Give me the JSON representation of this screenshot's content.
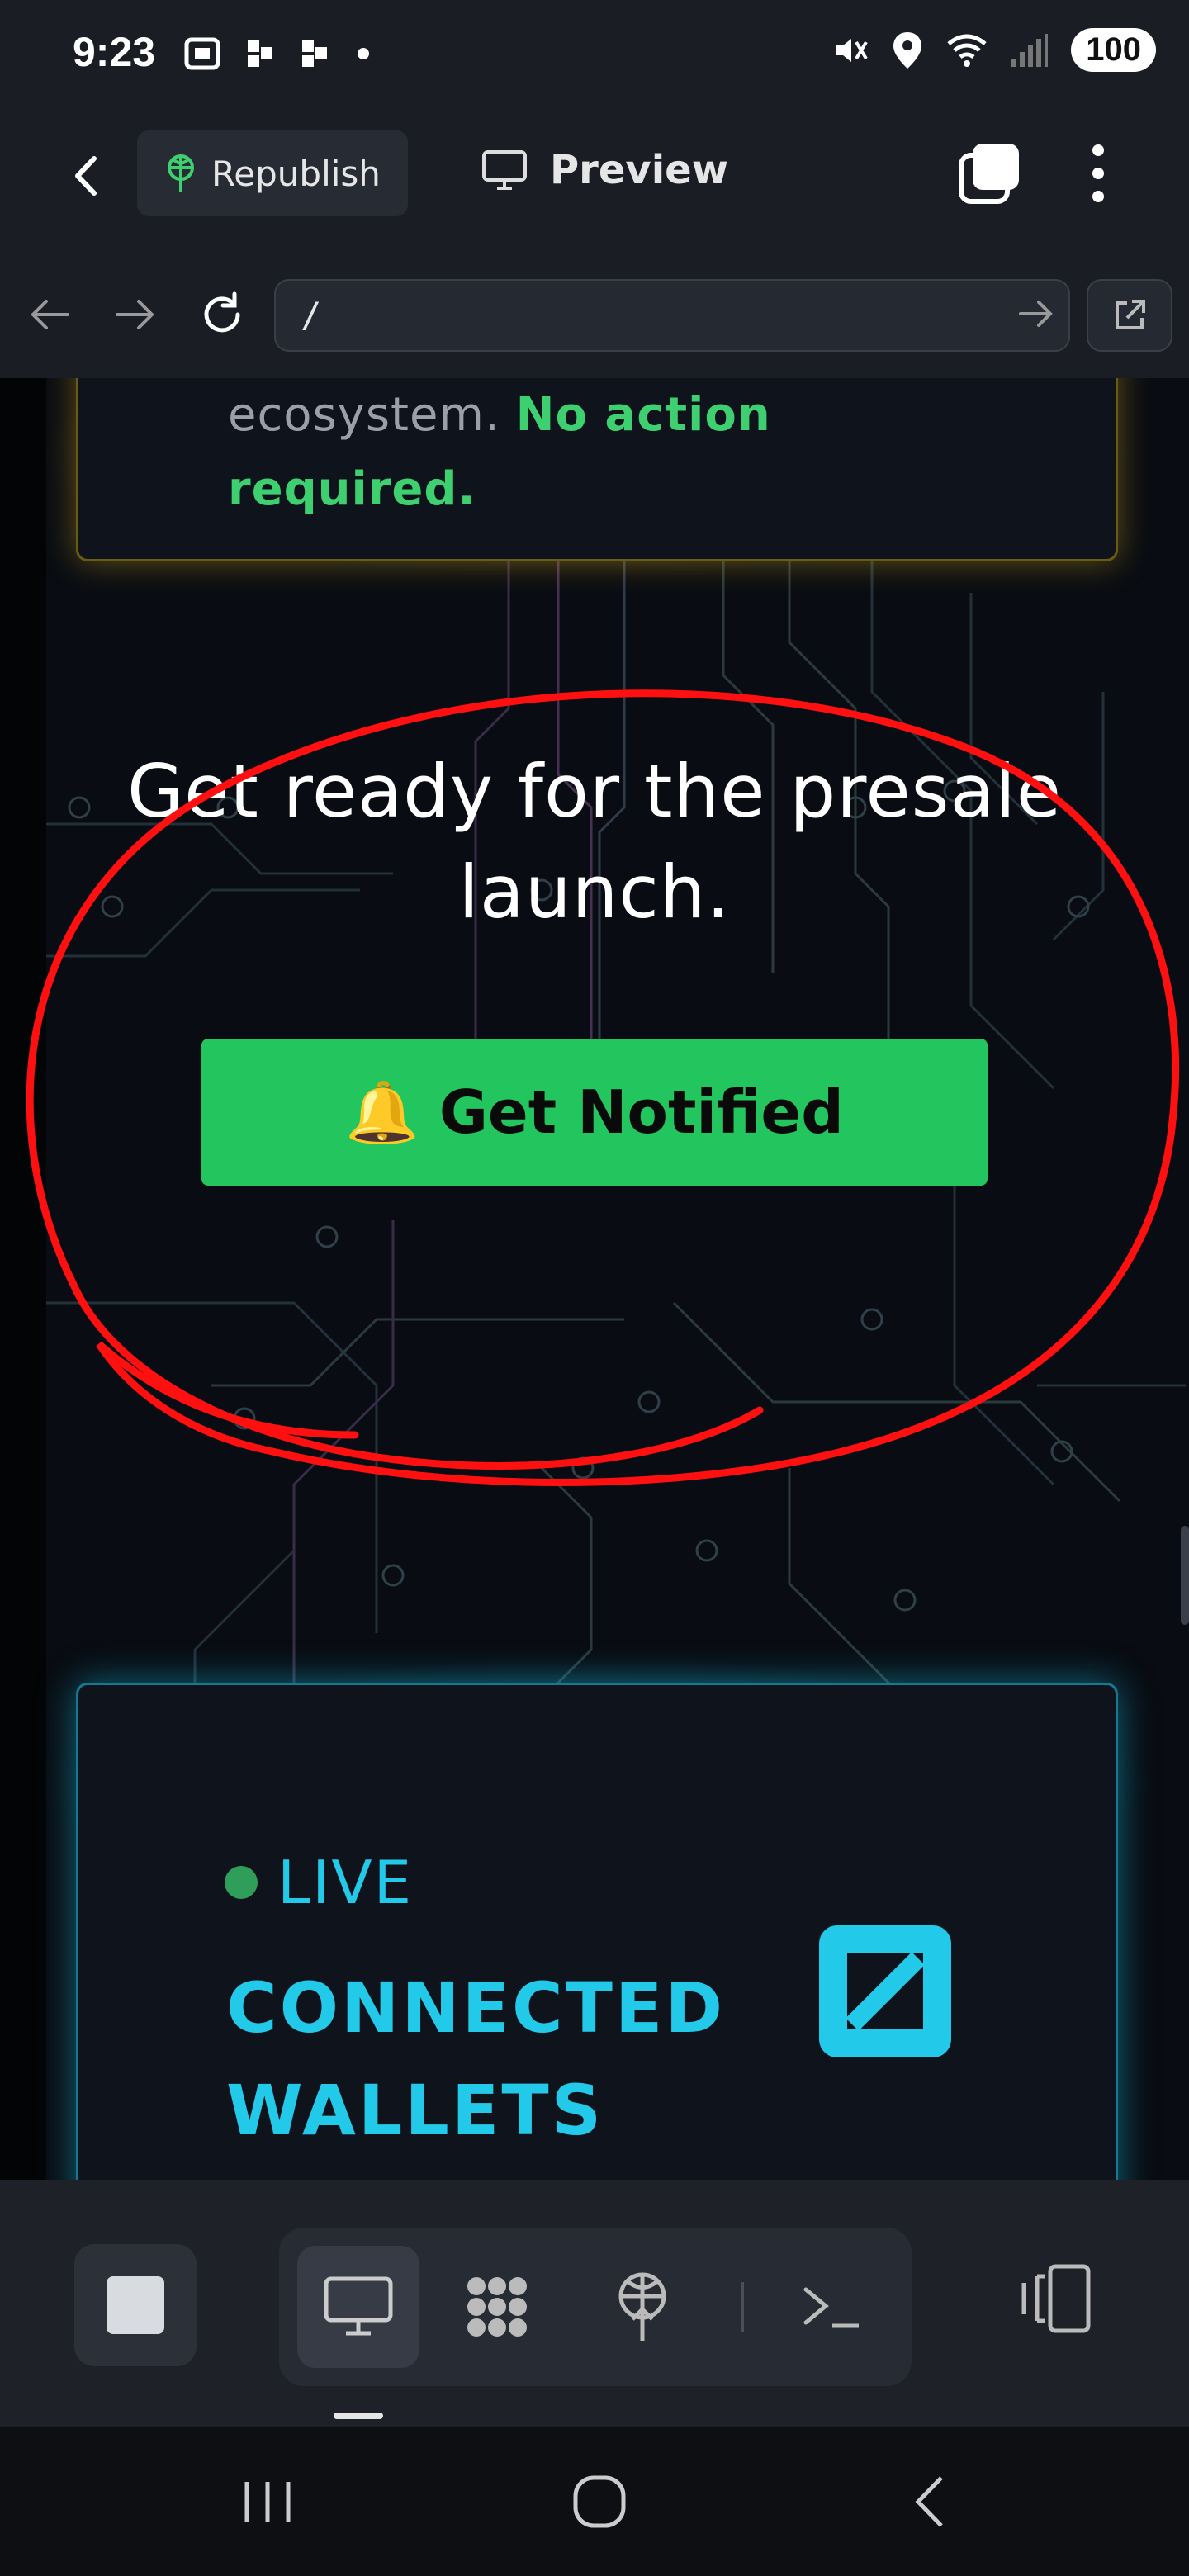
{
  "status_bar": {
    "time": "9:23",
    "battery": "100",
    "left_icons": [
      "screenshot-icon",
      "app-notification-icon",
      "app-notification-icon",
      "dot-icon"
    ],
    "right_icons": [
      "mute-icon",
      "location-icon",
      "wifi-icon",
      "signal-icon"
    ]
  },
  "app_header": {
    "republish_label": "Republish",
    "preview_label": "Preview"
  },
  "url_bar": {
    "value": "/"
  },
  "content": {
    "top_card": {
      "text_muted": "ecosystem.",
      "text_highlight_1": "No action",
      "text_highlight_2": "required."
    },
    "headline_line1": "Get ready for the presale",
    "headline_line2": "launch.",
    "notify_button": {
      "icon": "🔔",
      "label": "Get Notified"
    },
    "live_card": {
      "status_label": "LIVE",
      "title_line1": "CONNECTED",
      "title_line2": "WALLETS"
    }
  },
  "colors": {
    "accent_green": "#22c55e",
    "accent_cyan": "#22c9e8",
    "gold_border": "#6b5a12",
    "annotation_red": "#ff0000"
  }
}
